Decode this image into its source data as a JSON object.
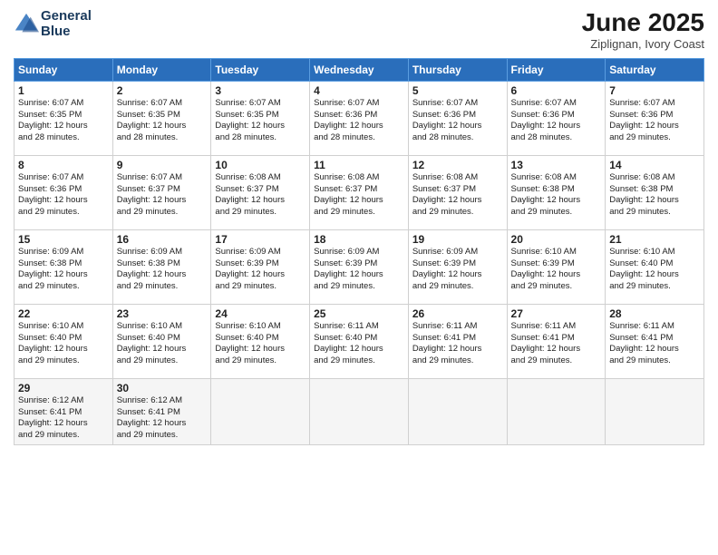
{
  "header": {
    "logo_line1": "General",
    "logo_line2": "Blue",
    "month": "June 2025",
    "location": "Ziplignan, Ivory Coast"
  },
  "weekdays": [
    "Sunday",
    "Monday",
    "Tuesday",
    "Wednesday",
    "Thursday",
    "Friday",
    "Saturday"
  ],
  "weeks": [
    [
      {
        "day": "1",
        "info": "Sunrise: 6:07 AM\nSunset: 6:35 PM\nDaylight: 12 hours\nand 28 minutes."
      },
      {
        "day": "2",
        "info": "Sunrise: 6:07 AM\nSunset: 6:35 PM\nDaylight: 12 hours\nand 28 minutes."
      },
      {
        "day": "3",
        "info": "Sunrise: 6:07 AM\nSunset: 6:35 PM\nDaylight: 12 hours\nand 28 minutes."
      },
      {
        "day": "4",
        "info": "Sunrise: 6:07 AM\nSunset: 6:36 PM\nDaylight: 12 hours\nand 28 minutes."
      },
      {
        "day": "5",
        "info": "Sunrise: 6:07 AM\nSunset: 6:36 PM\nDaylight: 12 hours\nand 28 minutes."
      },
      {
        "day": "6",
        "info": "Sunrise: 6:07 AM\nSunset: 6:36 PM\nDaylight: 12 hours\nand 28 minutes."
      },
      {
        "day": "7",
        "info": "Sunrise: 6:07 AM\nSunset: 6:36 PM\nDaylight: 12 hours\nand 29 minutes."
      }
    ],
    [
      {
        "day": "8",
        "info": "Sunrise: 6:07 AM\nSunset: 6:36 PM\nDaylight: 12 hours\nand 29 minutes."
      },
      {
        "day": "9",
        "info": "Sunrise: 6:07 AM\nSunset: 6:37 PM\nDaylight: 12 hours\nand 29 minutes."
      },
      {
        "day": "10",
        "info": "Sunrise: 6:08 AM\nSunset: 6:37 PM\nDaylight: 12 hours\nand 29 minutes."
      },
      {
        "day": "11",
        "info": "Sunrise: 6:08 AM\nSunset: 6:37 PM\nDaylight: 12 hours\nand 29 minutes."
      },
      {
        "day": "12",
        "info": "Sunrise: 6:08 AM\nSunset: 6:37 PM\nDaylight: 12 hours\nand 29 minutes."
      },
      {
        "day": "13",
        "info": "Sunrise: 6:08 AM\nSunset: 6:38 PM\nDaylight: 12 hours\nand 29 minutes."
      },
      {
        "day": "14",
        "info": "Sunrise: 6:08 AM\nSunset: 6:38 PM\nDaylight: 12 hours\nand 29 minutes."
      }
    ],
    [
      {
        "day": "15",
        "info": "Sunrise: 6:09 AM\nSunset: 6:38 PM\nDaylight: 12 hours\nand 29 minutes."
      },
      {
        "day": "16",
        "info": "Sunrise: 6:09 AM\nSunset: 6:38 PM\nDaylight: 12 hours\nand 29 minutes."
      },
      {
        "day": "17",
        "info": "Sunrise: 6:09 AM\nSunset: 6:39 PM\nDaylight: 12 hours\nand 29 minutes."
      },
      {
        "day": "18",
        "info": "Sunrise: 6:09 AM\nSunset: 6:39 PM\nDaylight: 12 hours\nand 29 minutes."
      },
      {
        "day": "19",
        "info": "Sunrise: 6:09 AM\nSunset: 6:39 PM\nDaylight: 12 hours\nand 29 minutes."
      },
      {
        "day": "20",
        "info": "Sunrise: 6:10 AM\nSunset: 6:39 PM\nDaylight: 12 hours\nand 29 minutes."
      },
      {
        "day": "21",
        "info": "Sunrise: 6:10 AM\nSunset: 6:40 PM\nDaylight: 12 hours\nand 29 minutes."
      }
    ],
    [
      {
        "day": "22",
        "info": "Sunrise: 6:10 AM\nSunset: 6:40 PM\nDaylight: 12 hours\nand 29 minutes."
      },
      {
        "day": "23",
        "info": "Sunrise: 6:10 AM\nSunset: 6:40 PM\nDaylight: 12 hours\nand 29 minutes."
      },
      {
        "day": "24",
        "info": "Sunrise: 6:10 AM\nSunset: 6:40 PM\nDaylight: 12 hours\nand 29 minutes."
      },
      {
        "day": "25",
        "info": "Sunrise: 6:11 AM\nSunset: 6:40 PM\nDaylight: 12 hours\nand 29 minutes."
      },
      {
        "day": "26",
        "info": "Sunrise: 6:11 AM\nSunset: 6:41 PM\nDaylight: 12 hours\nand 29 minutes."
      },
      {
        "day": "27",
        "info": "Sunrise: 6:11 AM\nSunset: 6:41 PM\nDaylight: 12 hours\nand 29 minutes."
      },
      {
        "day": "28",
        "info": "Sunrise: 6:11 AM\nSunset: 6:41 PM\nDaylight: 12 hours\nand 29 minutes."
      }
    ],
    [
      {
        "day": "29",
        "info": "Sunrise: 6:12 AM\nSunset: 6:41 PM\nDaylight: 12 hours\nand 29 minutes."
      },
      {
        "day": "30",
        "info": "Sunrise: 6:12 AM\nSunset: 6:41 PM\nDaylight: 12 hours\nand 29 minutes."
      },
      {
        "day": "",
        "info": ""
      },
      {
        "day": "",
        "info": ""
      },
      {
        "day": "",
        "info": ""
      },
      {
        "day": "",
        "info": ""
      },
      {
        "day": "",
        "info": ""
      }
    ]
  ]
}
